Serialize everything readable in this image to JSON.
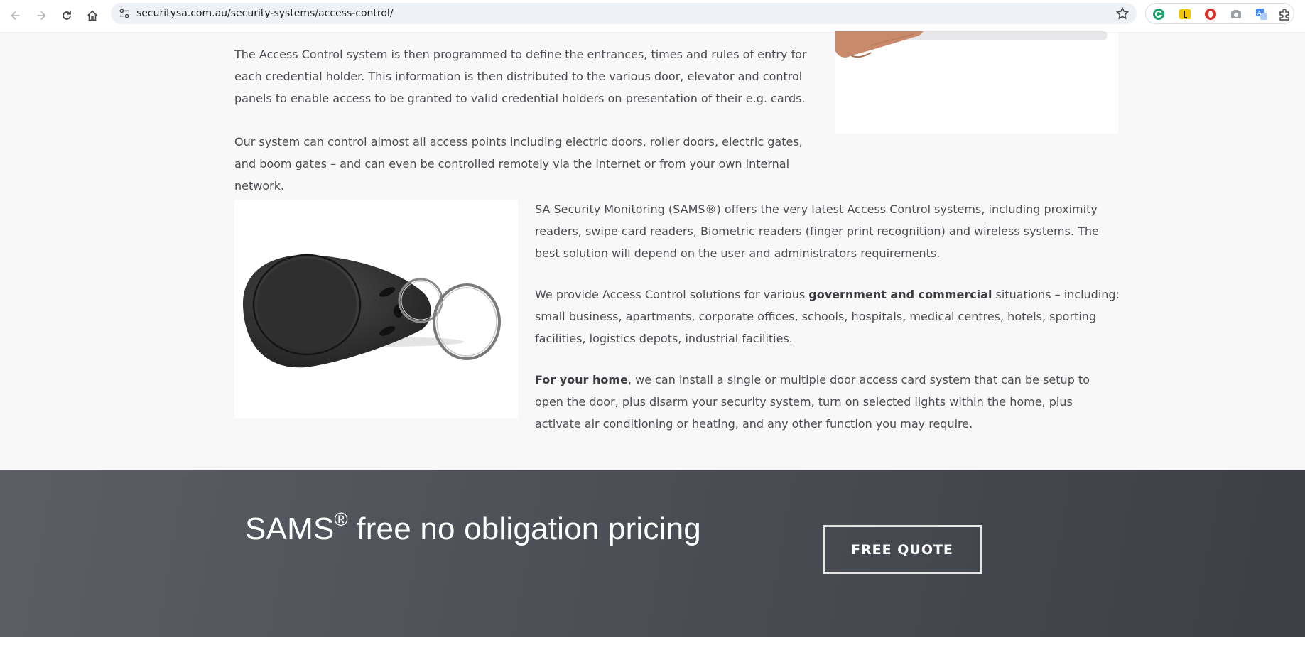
{
  "browser": {
    "url": "securitysa.com.au/security-systems/access-control/",
    "back_icon": "back-arrow-icon",
    "forward_icon": "forward-arrow-icon",
    "reload_icon": "reload-icon",
    "home_icon": "home-icon",
    "bookmark_icon": "star-icon",
    "extensions": [
      "grammarly-icon",
      "extension-icon",
      "shield-extension-icon",
      "camera-icon",
      "translate-icon",
      "puzzle-icon"
    ]
  },
  "intro": {
    "p1": "The Access Control system is then programmed to define the entrances, times and rules of entry for each credential holder. This information is then distributed to the various door, elevator and control panels to enable access to be granted to valid credential holders on presentation of their e.g. cards.",
    "p2": "Our system can control almost all access points including electric doors, roller doors, electric gates, and boom gates – and can even be controlled remotely via the internet or from your own internal network."
  },
  "features": {
    "p1": "SA Security Monitoring (SAMS®) offers the very latest Access Control systems, including proximity readers, swipe card readers, Biometric readers (finger print recognition) and wireless systems. The best solution will depend on the user and administrators requirements.",
    "p2_a": "We provide Access Control solutions for various ",
    "p2_bold": "government and commercial",
    "p2_b": " situations – including: small business, apartments, corporate offices, schools, hospitals, medical centres, hotels, sporting facilities, logistics depots, industrial facilities.",
    "p3_bold": "For your home",
    "p3_rest": ", we can install a single or multiple door access card system that can be setup to open the door, plus disarm your security system, turn on selected lights within the home, plus activate air conditioning or heating, and any other function you may require."
  },
  "cta": {
    "title_main": "SAMS",
    "title_reg": "®",
    "title_rest": " free no obligation pricing",
    "button_label": "FREE QUOTE"
  }
}
